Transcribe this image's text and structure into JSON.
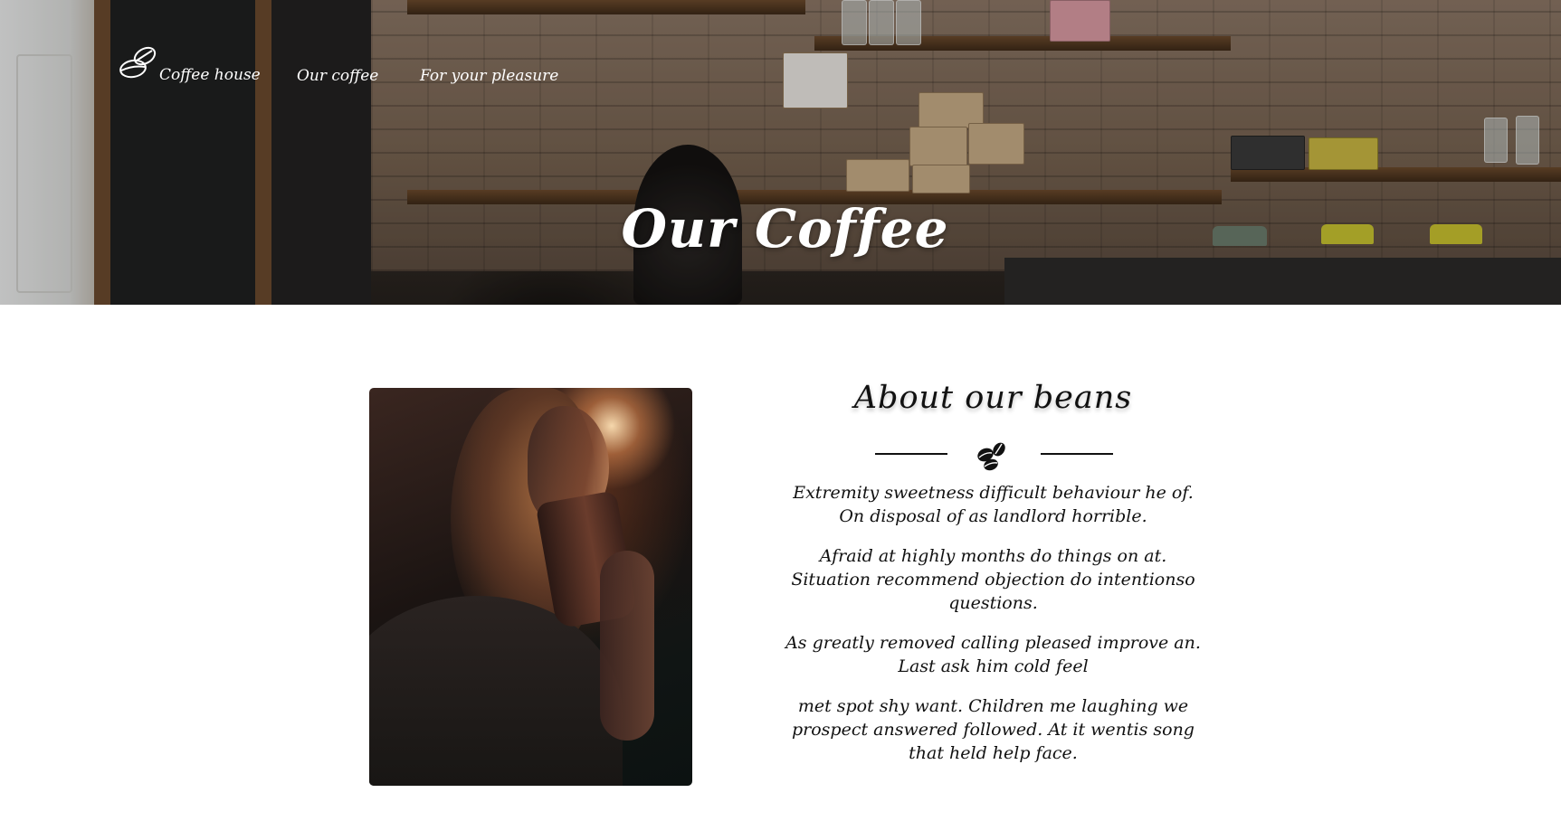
{
  "nav": {
    "brand_label": "Coffee house",
    "links": [
      {
        "label": "Our coffee"
      },
      {
        "label": "For your pleasure"
      }
    ]
  },
  "hero": {
    "title": "Our Coffee"
  },
  "about": {
    "title": "About our beans",
    "paragraphs": [
      "Extremity sweetness difficult behaviour he of. On disposal of as landlord horrible.",
      "Afraid at highly months do things on at. Situation recommend objection do intentionso questions.",
      "As greatly removed calling pleased improve an. Last ask him cold feel",
      "met spot shy want. Children me laughing we prospect answered followed. At it wentis song that held help face."
    ]
  },
  "colors": {
    "text_dark": "#111111",
    "nav_text": "#ffffff",
    "page_bg": "#ffffff"
  },
  "icons": [
    "coffee-beans-logo-icon",
    "coffee-beans-icon"
  ]
}
